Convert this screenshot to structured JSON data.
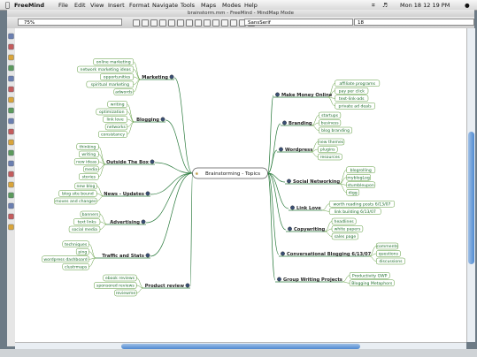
{
  "menubar": {
    "app_name": "FreeMind",
    "items": [
      "File",
      "Edit",
      "View",
      "Insert",
      "Format",
      "Navigate",
      "Tools",
      "Maps",
      "Modes",
      "Help"
    ],
    "clock": "Mon 18 12 19 PM"
  },
  "window": {
    "title": "brainstorm.mm - FreeMind - MindMap Mode"
  },
  "toolbar": {
    "zoom": "75%",
    "font_name": "SansSerif",
    "font_size": "18"
  },
  "mindmap": {
    "center": "Brainstorming - Topics",
    "left_branches": [
      {
        "label": "Marketing",
        "children": [
          "online marketing",
          "network marketing ideas",
          "opportunities",
          "spiritual marketing",
          "adwords"
        ]
      },
      {
        "label": "Blogging",
        "children": [
          "writing",
          "optimization",
          "link love",
          "networks",
          "consistancy"
        ]
      },
      {
        "label": "Outside The Box",
        "children": [
          "thinking",
          "writing",
          "new ideas",
          "media",
          "stories"
        ]
      },
      {
        "label": "News - Updates",
        "children": [
          "new blog",
          "blog site bound",
          "moves and changes"
        ]
      },
      {
        "label": "Advertising",
        "children": [
          "banners",
          "text links",
          "social media"
        ]
      },
      {
        "label": "Traffic and Stats",
        "children": [
          "techniques",
          "ping",
          "wordpress dashboard",
          "clustrmaps"
        ]
      },
      {
        "label": "Product review",
        "children": [
          "ebook reviews",
          "sponsored reviews",
          "reviewme"
        ]
      }
    ],
    "right_branches": [
      {
        "label": "Make Money Online",
        "children": [
          "affiliate programs",
          "pay per click",
          "text-link-ads",
          "private ad deals"
        ]
      },
      {
        "label": "Branding",
        "children": [
          "startups",
          "business",
          "blog branding"
        ]
      },
      {
        "label": "Wordpress",
        "children": [
          "new themes",
          "plugins",
          "resources"
        ]
      },
      {
        "label": "Social Networking",
        "children": [
          "blogrolling",
          "myblogLog",
          "stumbleupon",
          "digg"
        ]
      },
      {
        "label": "Link Love",
        "children": [
          "worth reading posts 6/13/07",
          "link building 6/13/07"
        ]
      },
      {
        "label": "Copywriting",
        "children": [
          "headlines",
          "white papers",
          "sales page"
        ]
      },
      {
        "label": "Conversational Blogging 6/13/07",
        "children": [
          "comments",
          "questions",
          "discussions"
        ]
      },
      {
        "label": "Group Writing Projects",
        "children": [
          "Productivity GWP",
          "Blogging Metaphors"
        ]
      }
    ]
  },
  "colors": {
    "branch_line": "#2a7a3c",
    "leaf_border": "#5a9a3a",
    "leaf_text": "#1e6e2c",
    "branch_text": "#222222",
    "node_icon": "#3a4f75",
    "center_border": "#555555",
    "accent_red": "#c0392b"
  },
  "icons": [
    "apple-icon",
    "wifi-icon",
    "volume-icon",
    "spotlight-icon",
    "node-status-icon"
  ]
}
